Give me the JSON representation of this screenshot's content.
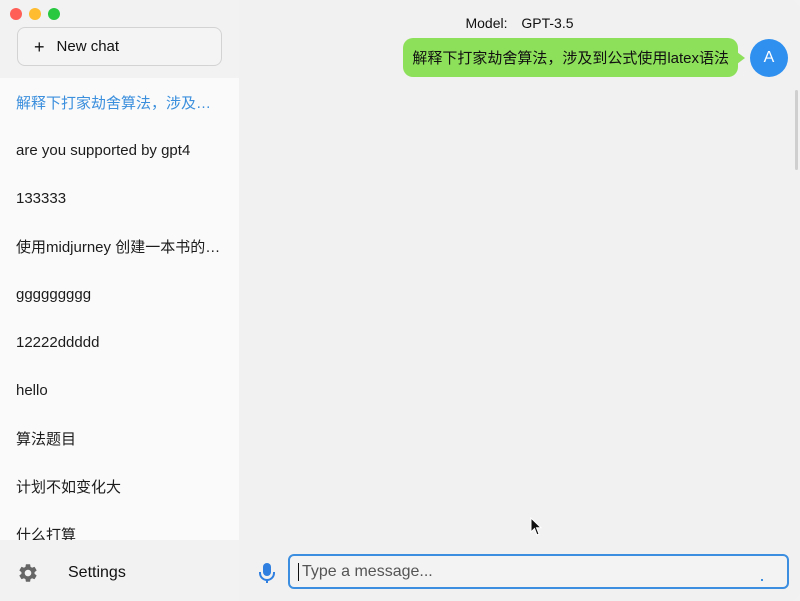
{
  "sidebar": {
    "new_chat_label": "New chat",
    "history": [
      {
        "title": "解释下打家劫舍算法，涉及到公式使用latex语法",
        "active": true
      },
      {
        "title": "are you supported by gpt4"
      },
      {
        "title": "133333"
      },
      {
        "title": "使用midjurney 创建一本书的封面"
      },
      {
        "title": "ggggggggg"
      },
      {
        "title": "12222ddddd"
      },
      {
        "title": "hello"
      },
      {
        "title": "算法题目"
      },
      {
        "title": "计划不如变化大"
      },
      {
        "title": "什么打算"
      }
    ],
    "settings_label": "Settings"
  },
  "header": {
    "model_label": "Model:",
    "model_value": "GPT-3.5"
  },
  "conversation": {
    "messages": [
      {
        "role": "user",
        "avatar": "A",
        "text": "解释下打家劫舍算法，涉及到公式使用latex语法"
      }
    ]
  },
  "composer": {
    "placeholder": "Type a message..."
  },
  "colors": {
    "accent": "#3c8fe0",
    "user_bubble": "#8de05a",
    "avatar_bg": "#2f90f0"
  },
  "icons": {
    "mic": "mic-icon",
    "settings": "gear-icon",
    "new_chat": "plus-icon"
  }
}
